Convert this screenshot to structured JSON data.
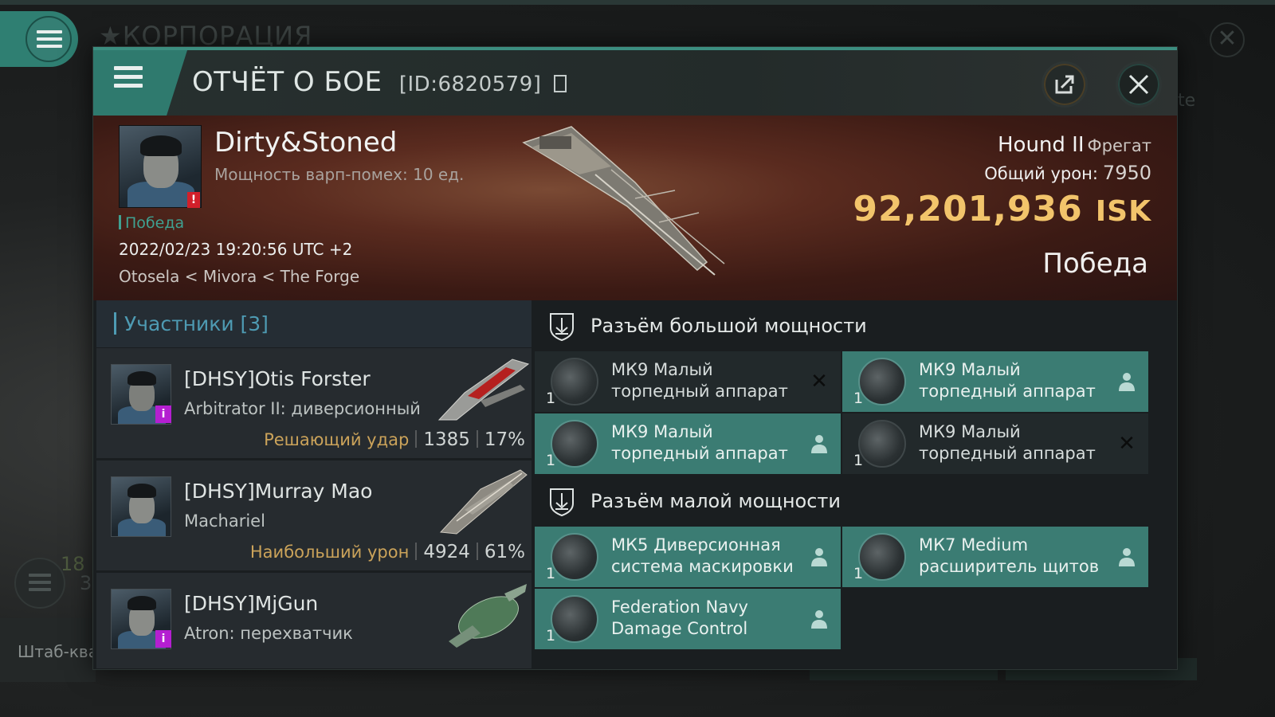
{
  "background": {
    "corp_title": "★КОРПОРАЦИЯ",
    "side_text": "te",
    "hq_label": "Штаб-ква",
    "num_a": "18",
    "num_b": "3"
  },
  "dialog": {
    "title": "ОТЧЁТ О БОЕ",
    "report_id": "[ID:6820579]"
  },
  "victim": {
    "name": "Dirty&Stoned",
    "warp_strength": "Мощность варп-помех: 10 ед.",
    "badge": "!",
    "result_tag": "Победа",
    "time": "2022/02/23 19:20:56 UTC +2",
    "location": "Otosela < Mivora < The Forge",
    "ship": "Hound II",
    "ship_class": "Фрегат",
    "damage_label": "Общий урон:",
    "damage_value": "7950",
    "isk_value": "92,201,936",
    "isk_unit": "ISK",
    "result": "Победа"
  },
  "participants": {
    "header": "Участники [3]",
    "items": [
      {
        "name": "[DHSY]Otis Forster",
        "ship": "Arbitrator II: диверсионный",
        "role": "Решающий удар",
        "damage": "1385",
        "percent": "17%",
        "badge": "i"
      },
      {
        "name": "[DHSY]Murray Mao",
        "ship": "Machariel",
        "role": "Наибольший урон",
        "damage": "4924",
        "percent": "61%",
        "badge": ""
      },
      {
        "name": "[DHSY]MjGun",
        "ship": "Atron: перехватчик",
        "role": "",
        "damage": "",
        "percent": "",
        "badge": "i"
      }
    ]
  },
  "fittings": {
    "high_slot_header": "Разъём большой мощности",
    "mid_slot_header": "Разъём малой мощности",
    "high_modules": [
      {
        "qty": "1",
        "name": "МК9 Малый торпедный аппарат",
        "status": "destroyed"
      },
      {
        "qty": "1",
        "name": "МК9 Малый торпедный аппарат",
        "status": "dropped"
      },
      {
        "qty": "1",
        "name": "МК9 Малый торпедный аппарат",
        "status": "dropped"
      },
      {
        "qty": "1",
        "name": "МК9 Малый торпедный аппарат",
        "status": "destroyed"
      }
    ],
    "mid_modules": [
      {
        "qty": "1",
        "name": "МК5 Диверсионная система маскировки",
        "status": "dropped"
      },
      {
        "qty": "1",
        "name": "МК7 Medium расширитель щитов",
        "status": "dropped"
      },
      {
        "qty": "1",
        "name": "Federation Navy Damage Control",
        "status": "dropped"
      }
    ]
  },
  "colors": {
    "accent": "#3c8e80",
    "isk": "#f2c46b",
    "fitted_module": "#3b7c73",
    "role_text": "#cba35a",
    "participants_header": "#4e9bb3"
  }
}
